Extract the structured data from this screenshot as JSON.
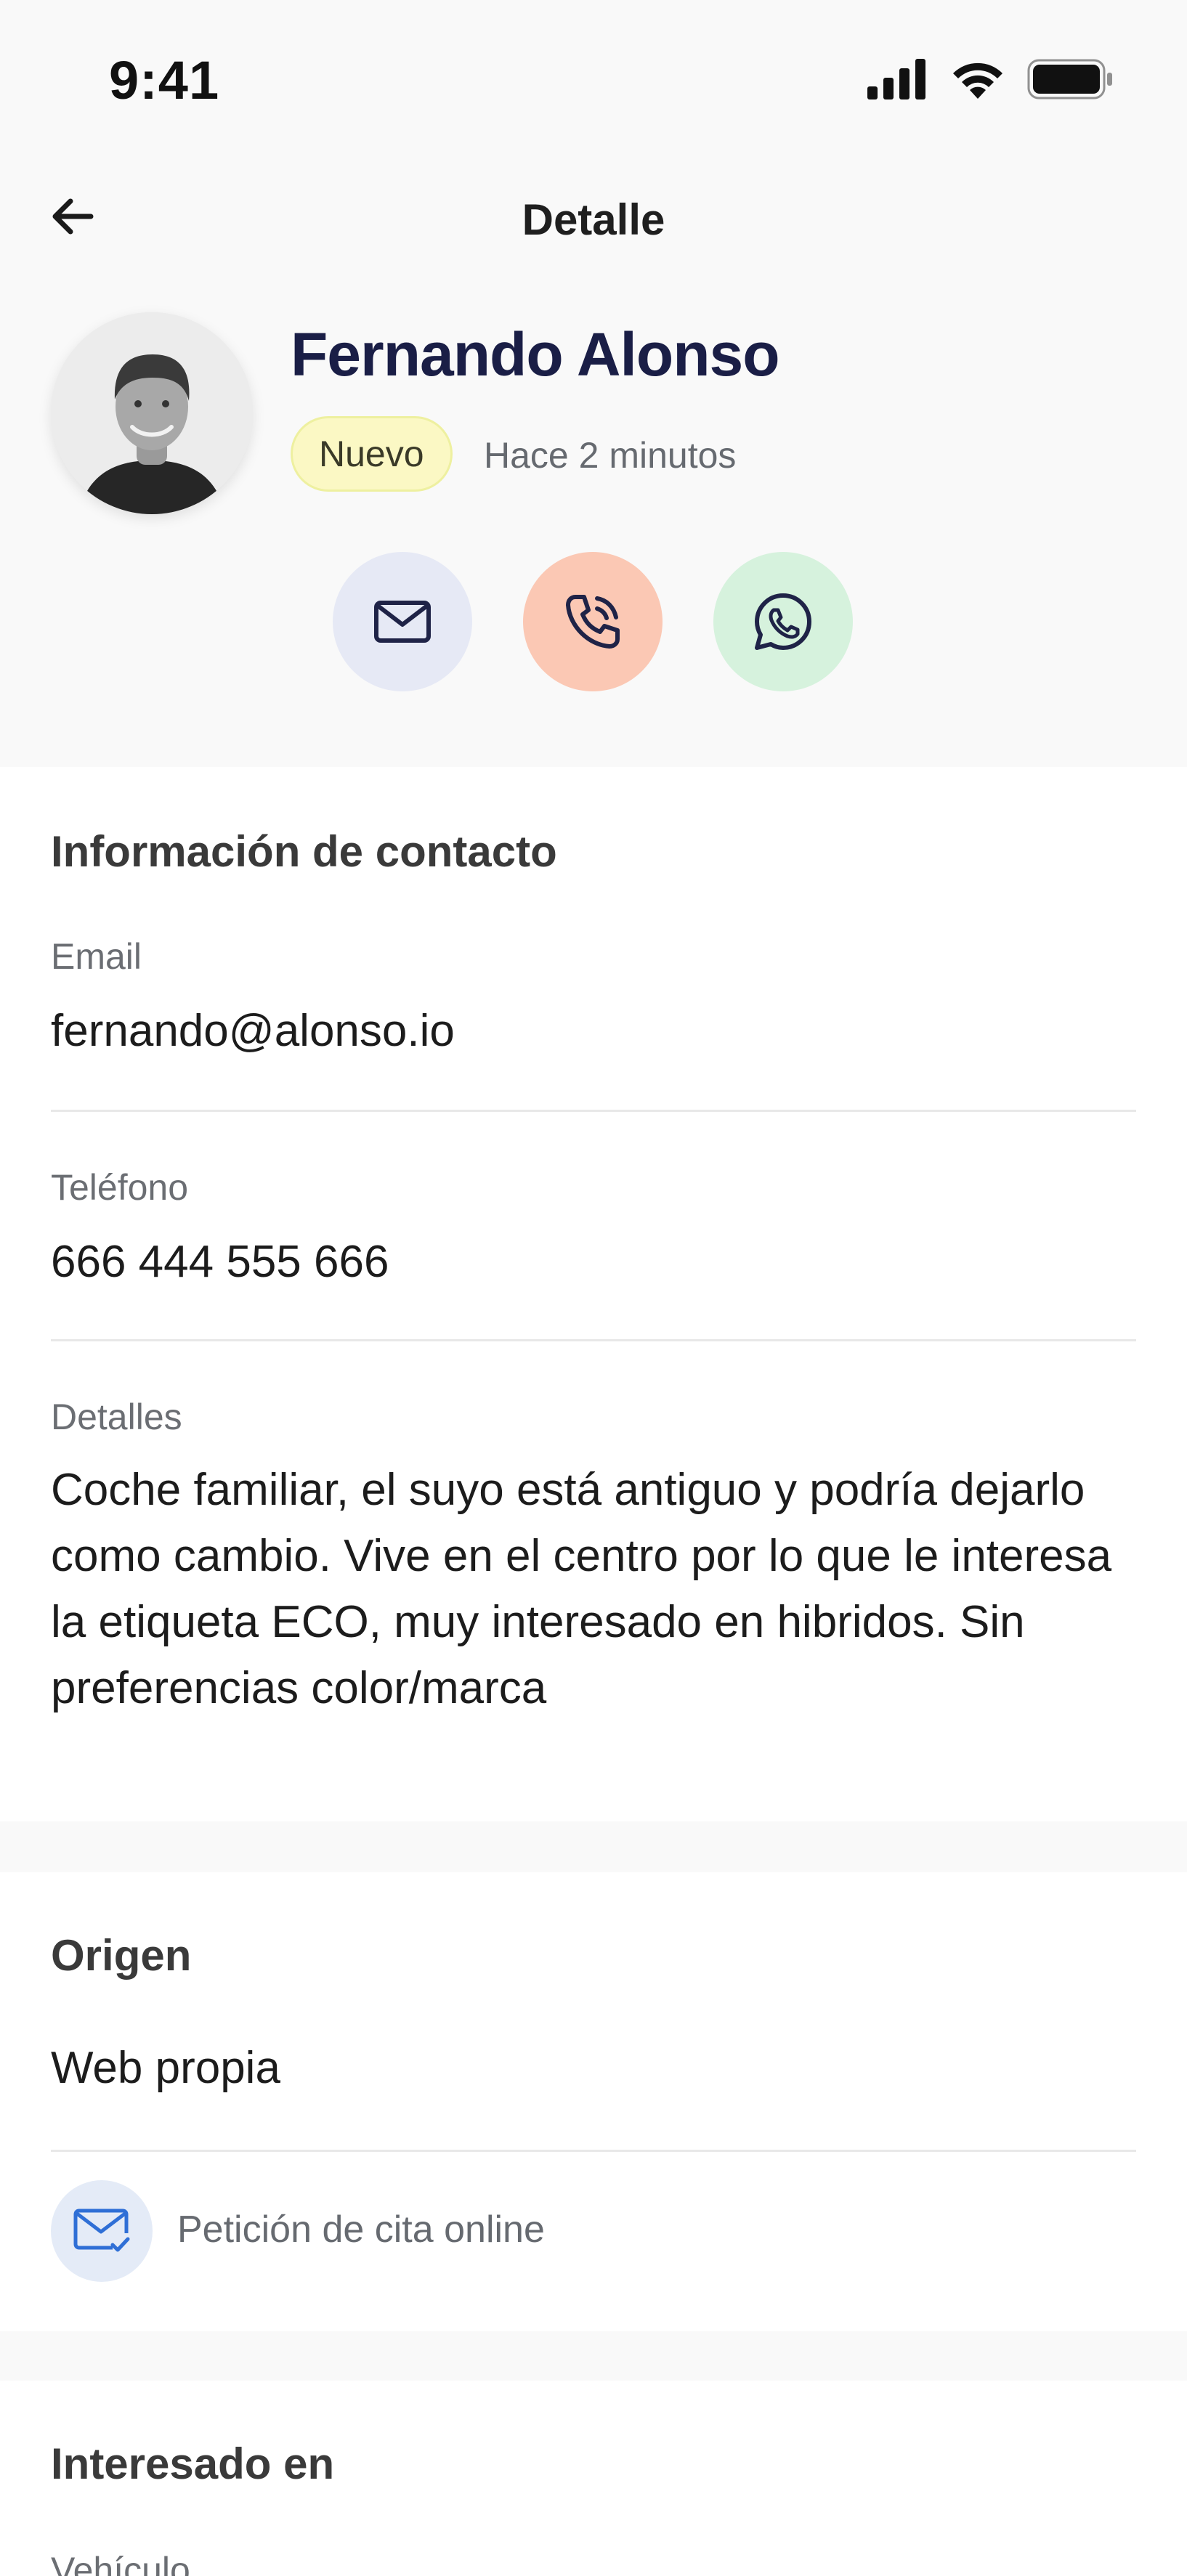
{
  "status_bar": {
    "time": "9:41"
  },
  "nav": {
    "title": "Detalle"
  },
  "profile": {
    "name": "Fernando Alonso",
    "badge": "Nuevo",
    "time_ago": "Hace 2 minutos"
  },
  "actions": {
    "email_icon": "mail-icon",
    "phone_icon": "phone-call-icon",
    "whatsapp_icon": "whatsapp-icon"
  },
  "contact": {
    "title": "Información de contacto",
    "email_label": "Email",
    "email_value": "fernando@alonso.io",
    "phone_label": "Teléfono",
    "phone_value": "666 444 555 666",
    "details_label": "Detalles",
    "details_value": "Coche familiar, el suyo está antiguo y podría dejarlo como cambio. Vive en el centro por lo que le interesa la etiqueta ECO, muy interesado en hibridos. Sin preferencias color/marca"
  },
  "origin": {
    "title": "Origen",
    "value": "Web propia",
    "request_label": "Petición de cita online"
  },
  "interest": {
    "title": "Interesado en",
    "vehicle_label": "Vehículo"
  },
  "colors": {
    "name": "#1a1e46",
    "badge_bg": "#fbf8c4",
    "email_btn": "#e6e9f5",
    "phone_btn": "#fbc8b4",
    "whatsapp_btn": "#d6f2dd"
  }
}
